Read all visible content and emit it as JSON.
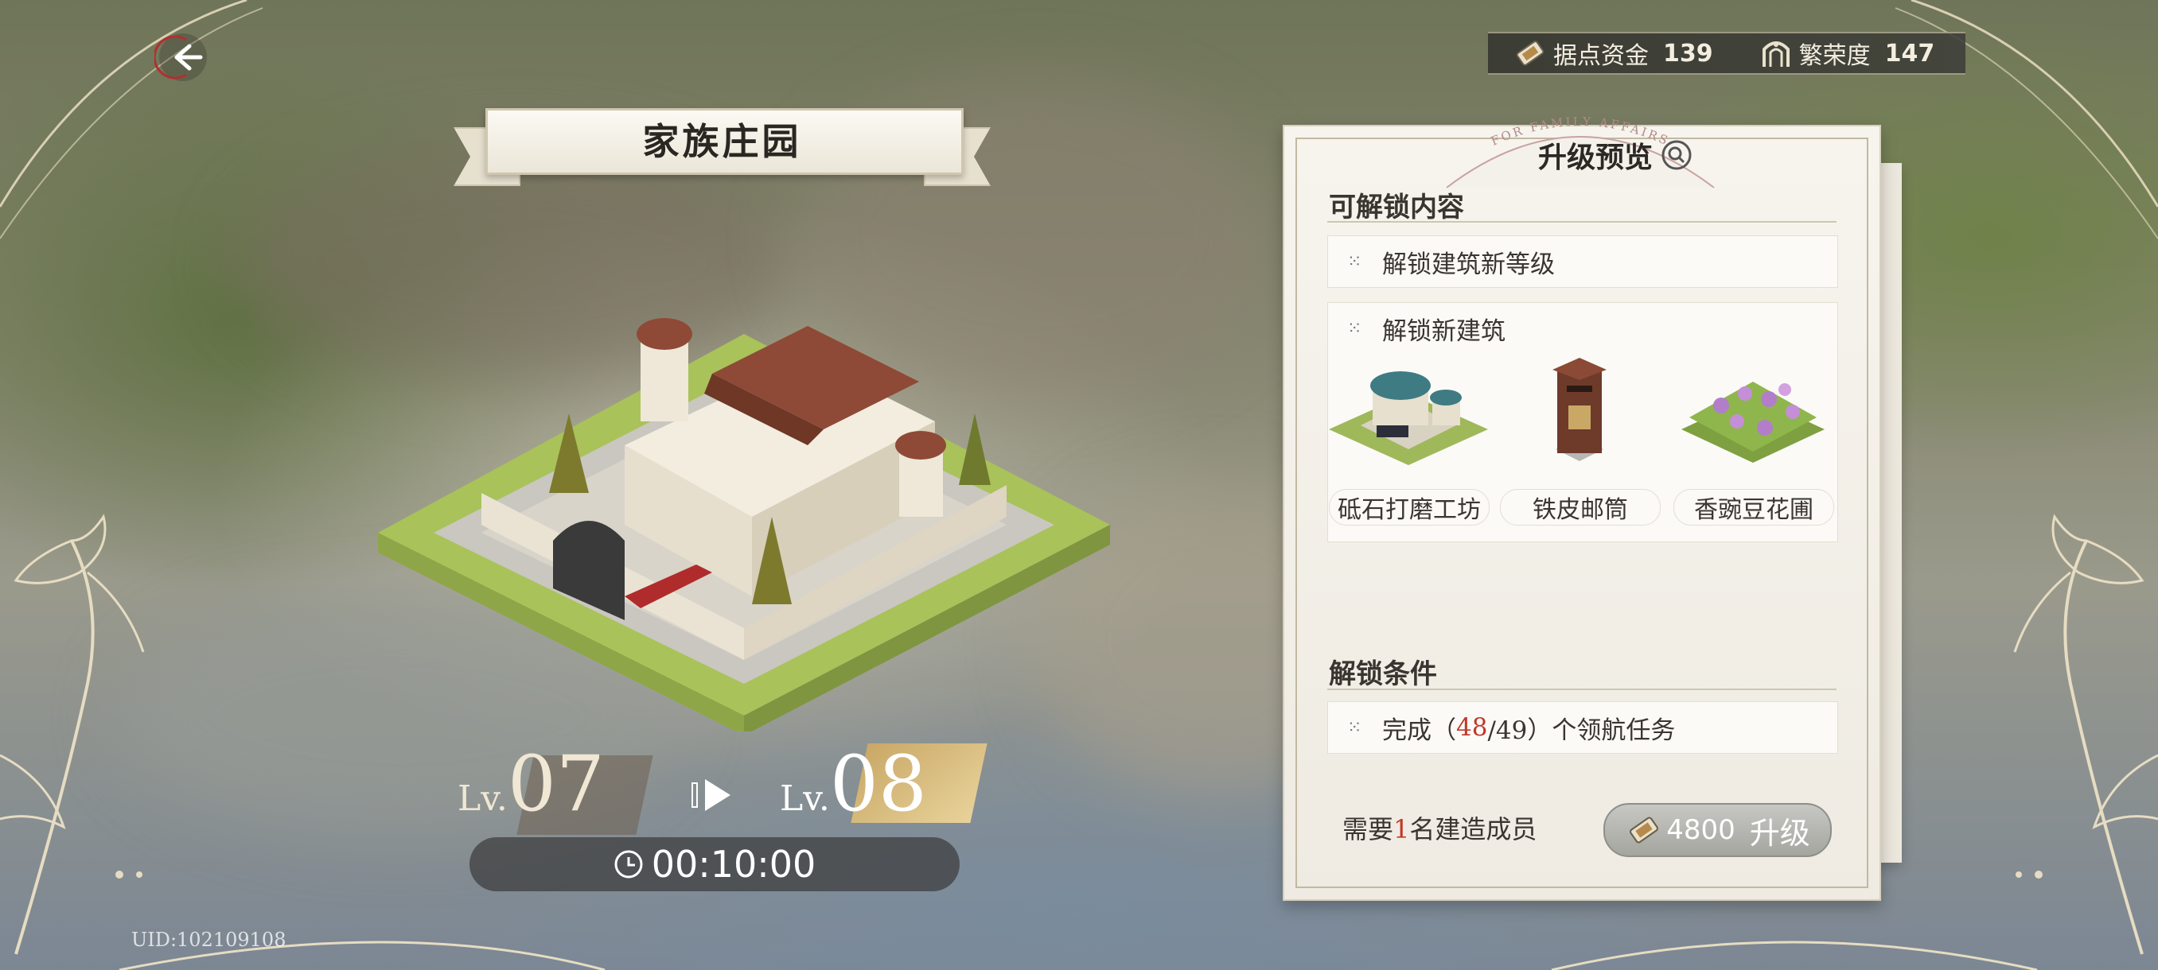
{
  "header": {
    "back_icon": "back-arrow-icon",
    "currencies": [
      {
        "icon": "base-funds-icon",
        "label": "据点资金",
        "value": "139"
      },
      {
        "icon": "prosperity-icon",
        "label": "繁荣度",
        "value": "147"
      }
    ]
  },
  "building": {
    "title": "家族庄园",
    "current_level_prefix": "Lv.",
    "current_level": "07",
    "next_level_prefix": "Lv.",
    "next_level": "08",
    "timer": "00:10:00"
  },
  "uid": "UID:102109108",
  "panel": {
    "arch_text": "FOR FAMILY AFFAIRS",
    "title": "升级预览",
    "unlock_section_title": "可解锁内容",
    "unlock_items": [
      "解锁建筑新等级",
      "解锁新建筑"
    ],
    "new_buildings": [
      {
        "name": "砥石打磨工坊",
        "display": "砥石打磨工坊"
      },
      {
        "name": "铁皮邮筒",
        "display": "铁皮邮筒"
      },
      {
        "name": "香豌豆花圃",
        "display": "香豌豆花圃"
      }
    ],
    "condition_section_title": "解锁条件",
    "condition": {
      "prefix": "完成（",
      "progress": "48",
      "suffix": "/49）个领航任务"
    },
    "requirement": {
      "prefix": "需要",
      "count": "1",
      "suffix": "名建造成员"
    },
    "upgrade_cost": "4800",
    "upgrade_label": "升级"
  },
  "colors": {
    "highlight_red": "#c0392b",
    "button_gray": "#b5b5b0"
  }
}
